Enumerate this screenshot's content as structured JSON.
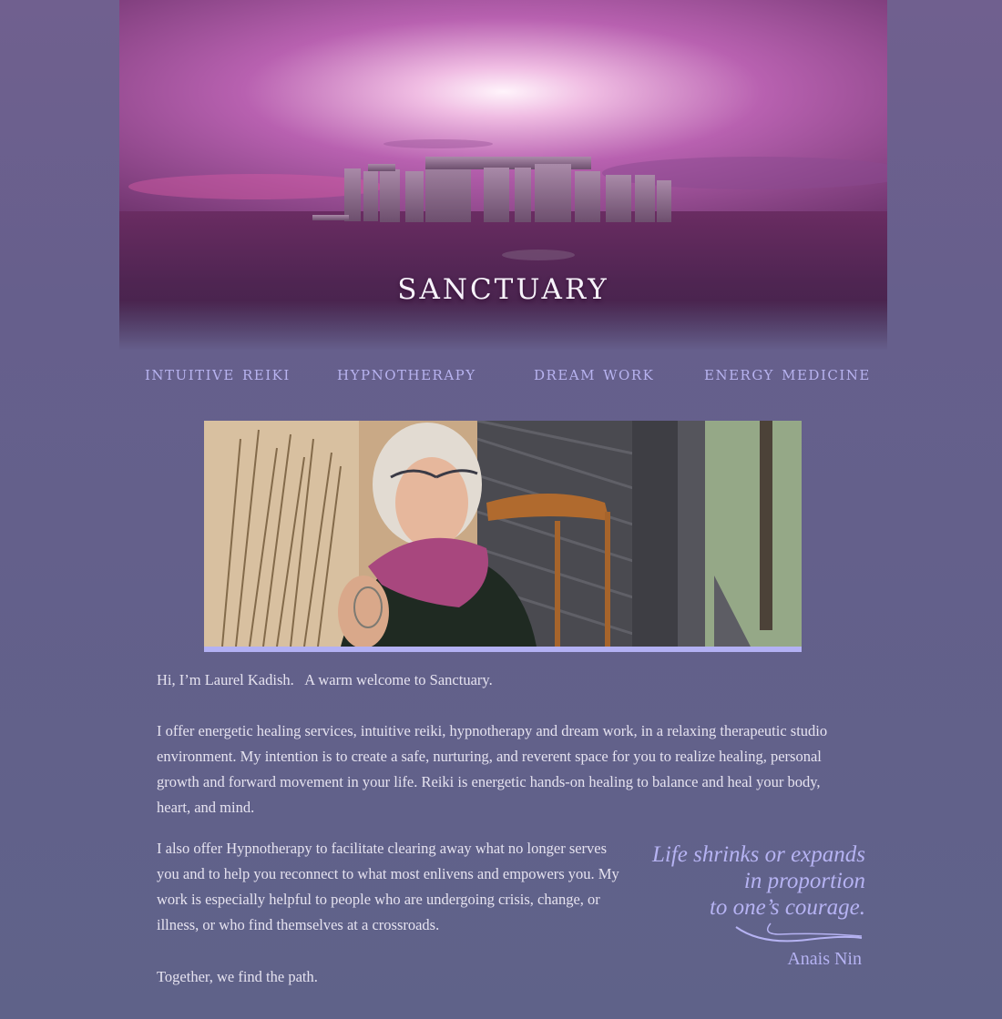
{
  "site": {
    "title": "sanctuary"
  },
  "nav": {
    "items": [
      {
        "label": "intuitive reiki"
      },
      {
        "label": "hypnotherapy"
      },
      {
        "label": "dream work"
      },
      {
        "label": "energy medicine"
      }
    ]
  },
  "content": {
    "greeting": "Hi, I’m Laurel Kadish.   A warm welcome to Sanctuary.",
    "paragraph1": "I offer energetic healing services, intuitive reiki, hypnotherapy and dream work, in a relaxing therapeutic studio environment. My intention is to create a safe, nurturing, and reverent space for you to realize healing, personal growth and forward movement in your life. Reiki is energetic hands-on healing to balance and heal your body, heart, and mind.",
    "paragraph2": "I also offer Hypnotherapy to facilitate clearing away what no longer serves you and to help you reconnect to what most enlivens and empowers you. My work is especially helpful to people who are undergoing crisis, change, or illness, or who find themselves at a crossroads.",
    "closing": "Together, we find the path."
  },
  "quote": {
    "lines": [
      "Life shrinks or expands",
      "in proportion",
      "to one’s courage."
    ],
    "author": "Anais Nin"
  },
  "colors": {
    "background": "#615f8a",
    "nav_text": "#b8b3f0",
    "accent_bar": "#b3b1f4",
    "quote_text": "#b6b3f3"
  }
}
